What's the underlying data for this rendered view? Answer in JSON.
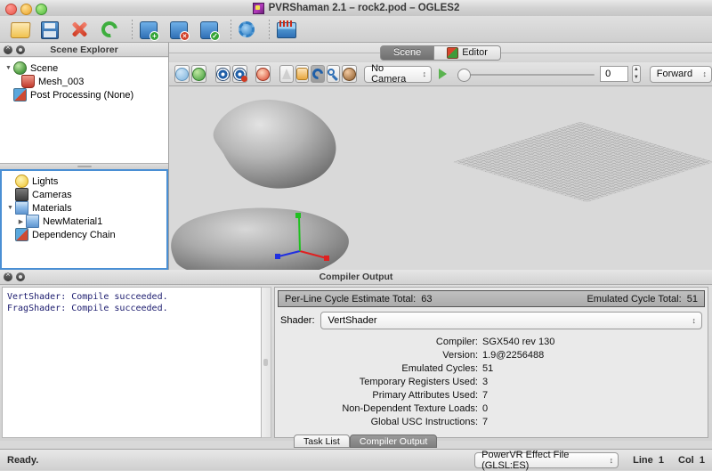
{
  "window": {
    "title": "PVRShaman 2.1 – rock2.pod – OGLES2",
    "app_icon": "pvrshaman-icon"
  },
  "toolbar": {
    "items": [
      {
        "name": "open-file-button",
        "icon": "folder-open-icon",
        "tip": "Open"
      },
      {
        "name": "save-file-button",
        "icon": "floppy-disk-icon",
        "tip": "Save"
      },
      {
        "name": "close-file-button",
        "icon": "red-x-icon",
        "tip": "Close"
      },
      {
        "name": "reload-button",
        "icon": "refresh-arrows-icon",
        "tip": "Reload"
      },
      {
        "name": "add-effect-button",
        "icon": "square-plus-icon",
        "tip": "Add"
      },
      {
        "name": "remove-effect-button",
        "icon": "square-delete-icon",
        "tip": "Remove"
      },
      {
        "name": "apply-effect-button",
        "icon": "square-check-icon",
        "tip": "Apply"
      },
      {
        "name": "preferences-button",
        "icon": "gear-icon",
        "tip": "Preferences"
      },
      {
        "name": "timeline-button",
        "icon": "timeline-icon",
        "tip": "Timeline"
      }
    ]
  },
  "scene_explorer": {
    "title": "Scene Explorer",
    "top_tree": [
      {
        "label": "Scene",
        "icon": "globe-icon",
        "twisty": "open",
        "depth": 0
      },
      {
        "label": "Mesh_003",
        "icon": "mesh-icon",
        "twisty": "none",
        "depth": 1
      },
      {
        "label": "Post Processing (None)",
        "icon": "post-processing-icon",
        "twisty": "none",
        "depth": 0
      }
    ],
    "bottom_tree": [
      {
        "label": "Lights",
        "icon": "light-bulb-icon",
        "twisty": "none",
        "depth": 0
      },
      {
        "label": "Cameras",
        "icon": "camera-icon",
        "twisty": "none",
        "depth": 0
      },
      {
        "label": "Materials",
        "icon": "material-icon",
        "twisty": "open",
        "depth": 0
      },
      {
        "label": "NewMaterial1",
        "icon": "material-icon",
        "twisty": "closed",
        "depth": 1
      },
      {
        "label": "Dependency Chain",
        "icon": "dependency-chain-icon",
        "twisty": "none",
        "depth": 0
      }
    ]
  },
  "view_tabs": [
    {
      "label": "Scene",
      "active": true,
      "icon": null
    },
    {
      "label": "Editor",
      "active": false,
      "icon": "editor-icon"
    }
  ],
  "view_toolbar": {
    "buttons": [
      {
        "name": "toggle-wireframe-button",
        "icon": "sphere-wire-icon",
        "pressed": false
      },
      {
        "name": "toggle-shaded-button",
        "icon": "sphere-shaded-icon",
        "pressed": false
      },
      {
        "name": "show-all-button",
        "icon": "eye-icon",
        "pressed": false
      },
      {
        "name": "hide-button",
        "icon": "eye-off-icon",
        "pressed": false
      },
      {
        "name": "bounding-box-button",
        "icon": "bounding-sphere-icon",
        "pressed": false
      },
      {
        "name": "select-tool-button",
        "icon": "cursor-arrow-icon",
        "pressed": false
      },
      {
        "name": "pan-tool-button",
        "icon": "hand-icon",
        "pressed": false
      },
      {
        "name": "rotate-tool-button",
        "icon": "rotate-icon",
        "pressed": true
      },
      {
        "name": "zoom-tool-button",
        "icon": "magnifier-icon",
        "pressed": false
      },
      {
        "name": "light-tool-button",
        "icon": "color-ball-icon",
        "pressed": false
      }
    ],
    "camera_select": "No Camera",
    "play_button": "play-icon",
    "frame_value": "0",
    "direction_select": "Forward"
  },
  "compiler_dock": {
    "title": "Compiler Output",
    "log_lines": "VertShader: Compile succeeded.\nFragShader: Compile succeeded.",
    "stat_bar": {
      "left_label": "Per-Line Cycle Estimate Total:",
      "left_value": "63",
      "right_label": "Emulated Cycle Total:",
      "right_value": "51"
    },
    "shader_label": "Shader:",
    "shader_select": "VertShader",
    "details": [
      {
        "key": "Compiler:",
        "value": "SGX540 rev 130"
      },
      {
        "key": "Version:",
        "value": "1.9@2256488"
      },
      {
        "key": "Emulated Cycles:",
        "value": "51"
      },
      {
        "key": "Temporary Registers Used:",
        "value": "3"
      },
      {
        "key": "Primary Attributes Used:",
        "value": "7"
      },
      {
        "key": "Non-Dependent Texture Loads:",
        "value": "0"
      },
      {
        "key": "Global USC Instructions:",
        "value": "7"
      }
    ],
    "bottom_tabs": [
      {
        "label": "Task List",
        "active": false
      },
      {
        "label": "Compiler Output",
        "active": true
      }
    ]
  },
  "statusbar": {
    "message": "Ready.",
    "file_type_select": "PowerVR Effect File (GLSL:ES)",
    "line_label": "Line",
    "line_value": "1",
    "col_label": "Col",
    "col_value": "1"
  },
  "colors": {
    "selection_blue": "#4a8fd4",
    "log_text": "#1b1b6e",
    "viewport_bg": "#d9d9d9",
    "axis_x": "#e02020",
    "axis_y": "#20c020",
    "axis_z": "#2030e0"
  }
}
